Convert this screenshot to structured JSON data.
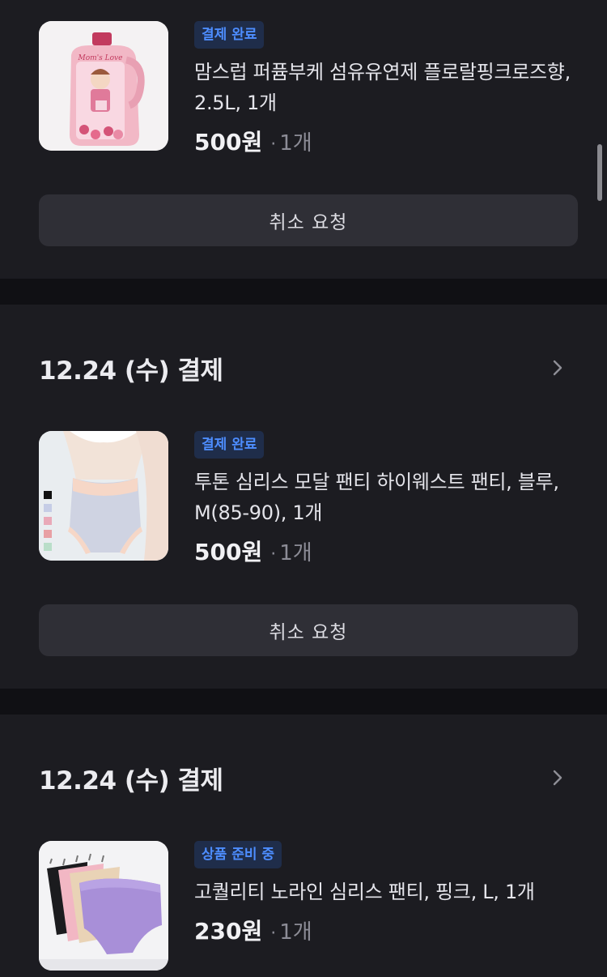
{
  "orders": [
    {
      "date_label": "",
      "items": [
        {
          "status": "결제 완료",
          "title_line1": "맘스럽 퍼퓸부케 섬유유연제 플로랄핑크로즈향,",
          "title_line2": "2.5L, 1개",
          "price": "500원",
          "dot": "·",
          "qty": "1개",
          "image_icon": "fabric-softener-bottle",
          "image_text": "Mom's Love"
        }
      ],
      "cancel_label": "취소 요청"
    },
    {
      "date_label": "12.24 (수) 결제",
      "items": [
        {
          "status": "결제 완료",
          "title_line1": "투톤 심리스 모달 팬티 하이웨스트 팬티, 블루,",
          "title_line2": "M(85-90), 1개",
          "price": "500원",
          "dot": "·",
          "qty": "1개",
          "image_icon": "panties-photo"
        }
      ],
      "cancel_label": "취소 요청"
    },
    {
      "date_label": "12.24 (수) 결제",
      "items": [
        {
          "status": "상품 준비 중",
          "title_line1": "고퀄리티 노라인 심리스 팬티, 핑크, L, 1개",
          "title_line2": "",
          "price": "230원",
          "dot": "·",
          "qty": "1개",
          "image_icon": "panties-set-photo"
        }
      ]
    }
  ],
  "colors": {
    "background": "#101014",
    "card": "#1c1c21",
    "button": "#2f2f36",
    "badge_bg": "#1f2d4a",
    "badge_text": "#4d8dff"
  }
}
